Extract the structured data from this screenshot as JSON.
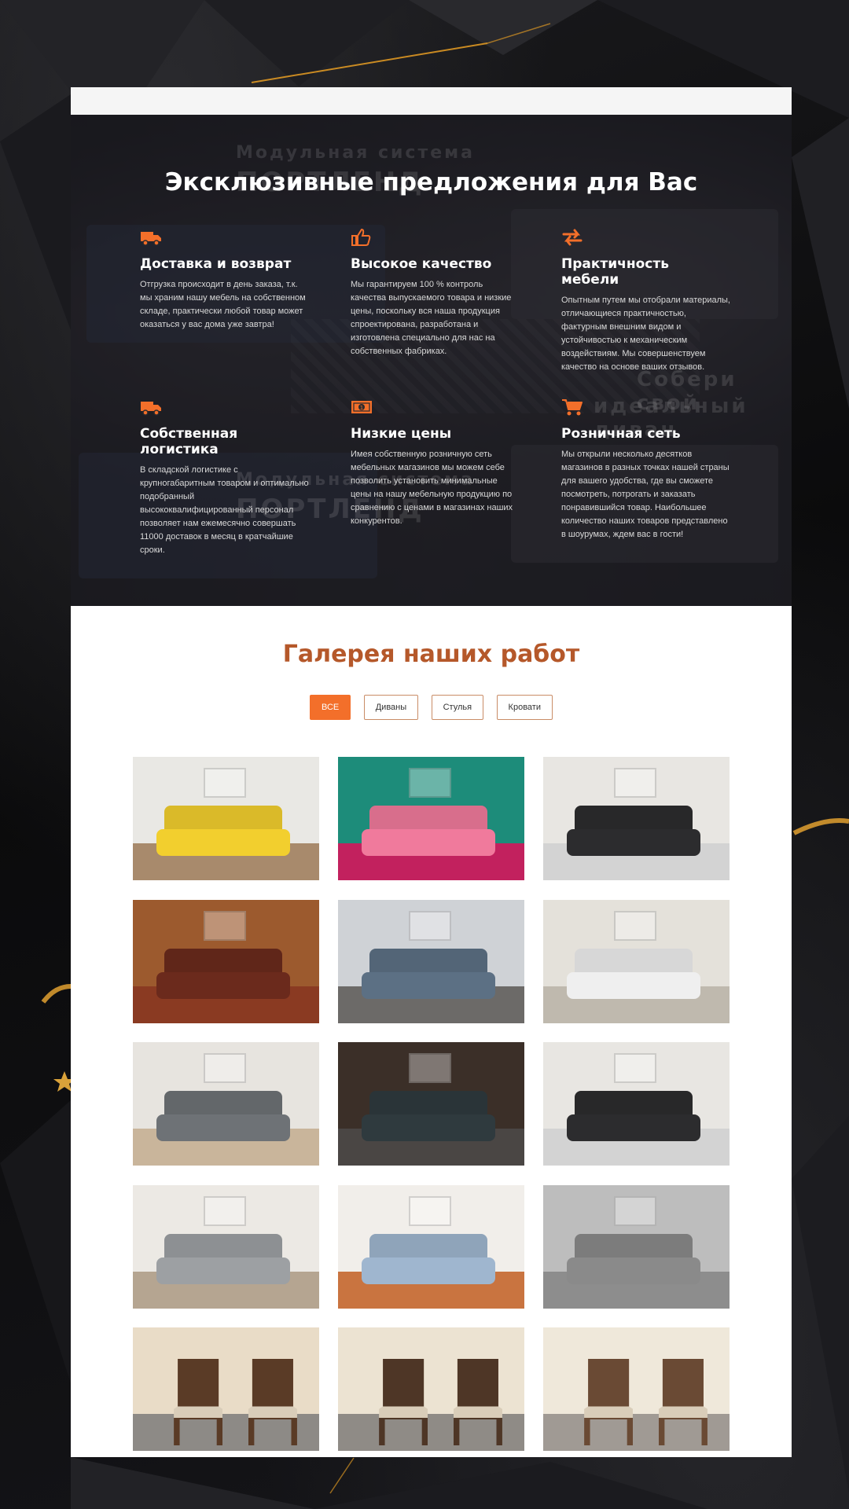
{
  "hero": {
    "ghost_text_1": "Модульная система",
    "ghost_text_2": "ПОРТЛЕНД",
    "ghost_text_3": "Собери свой",
    "ghost_text_4": "идеальный диван",
    "title": "Эксклюзивные предложения для Вас",
    "features": [
      {
        "icon": "truck-icon",
        "title": "Доставка и возврат",
        "text": "Отгрузка происходит в день заказа, т.к. мы храним нашу мебель на собственном складе, практически любой товар может оказаться у вас дома уже завтра!"
      },
      {
        "icon": "thumbs-up-icon",
        "title": "Высокое качество",
        "text": "Мы гарантируем 100 % контроль качества выпускаемого товара и низкие цены, поскольку вся наша продукция спроектирована, разработана и изготовлена специально для нас на собственных фабриках."
      },
      {
        "icon": "exchange-arrows-icon",
        "title": "Практичность мебели",
        "text": "Опытным путем мы отобрали материалы, отличающиеся практичностью, фактурным внешним видом и устойчивостью к механическим воздействиям. Мы совершенствуем качество на основе ваших отзывов."
      },
      {
        "icon": "truck-icon",
        "title": "Собственная логистика",
        "text": "В складской логистике с крупногабаритным товаром и оптимально подобранный высококвалифицированный персонал позволяет нам ежемесячно совершать 11000 доставок в месяц в кратчайшие сроки."
      },
      {
        "icon": "money-icon",
        "title": "Низкие цены",
        "text": "Имея собственную розничную сеть мебельных магазинов мы можем себе позволить установить минимальные цены на нашу мебельную продукцию по сравнению с ценами в магазинах наших конкурентов."
      },
      {
        "icon": "cart-icon",
        "title": "Розничная сеть",
        "text": "Мы открыли несколько десятков магазинов в разных точках нашей страны для вашего удобства, где вы сможете посмотреть, потрогать и заказать понравившийся товар. Наибольшее количество наших товаров представлено в шоурумах, ждем вас в гости!"
      }
    ]
  },
  "gallery": {
    "title": "Галерея наших работ",
    "filters": [
      "ВСЕ",
      "Диваны",
      "Стулья",
      "Кровати"
    ],
    "active_filter": "ВСЕ",
    "tiles": [
      {
        "subject": "yellow-sofa-photo",
        "wall": "#e9e8e4",
        "floor": "#a88a6c",
        "sofa": "#f2cf2e"
      },
      {
        "subject": "pink-neon-lounge-photo",
        "wall": "#1d8c7a",
        "floor": "#c2215e",
        "sofa": "#f07a9c"
      },
      {
        "subject": "dark-corner-sofa-photo",
        "wall": "#e8e6e2",
        "floor": "#d3d3d3",
        "sofa": "#2c2c2e"
      },
      {
        "subject": "striped-antique-sofa-photo",
        "wall": "#9c5a2e",
        "floor": "#8a3a22",
        "sofa": "#6b2a1c"
      },
      {
        "subject": "blue-sectional-photo",
        "wall": "#cfd2d6",
        "floor": "#6c6a68",
        "sofa": "#5c7084"
      },
      {
        "subject": "white-sofa-teal-photo",
        "wall": "#e4e1da",
        "floor": "#bfb9ae",
        "sofa": "#efefef"
      },
      {
        "subject": "grey-sofa-floral-photo",
        "wall": "#e7e4df",
        "floor": "#c9b59b",
        "sofa": "#6e7276"
      },
      {
        "subject": "dark-sofa-wood-photo",
        "wall": "#3b2f28",
        "floor": "#4a4644",
        "sofa": "#2f3a3e"
      },
      {
        "subject": "dark-corner-sofa-photo",
        "wall": "#e8e6e2",
        "floor": "#d3d3d3",
        "sofa": "#2c2c2e"
      },
      {
        "subject": "grey-tufted-sofa-photo",
        "wall": "#ece9e4",
        "floor": "#b5a591",
        "sofa": "#9da0a3"
      },
      {
        "subject": "light-blue-sofa-photo",
        "wall": "#f1eeea",
        "floor": "#c97440",
        "sofa": "#9fb6cf"
      },
      {
        "subject": "grey-channel-sofa-photo",
        "wall": "#bdbdbd",
        "floor": "#8d8d8d",
        "sofa": "#8a8a8a"
      },
      {
        "subject": "bar-stools-photo",
        "wall": "#e9dcc7",
        "floor": "#8d8a86",
        "sofa": "#5a3b26"
      },
      {
        "subject": "wooden-chairs-photo",
        "wall": "#ece3d2",
        "floor": "#8f8b86",
        "sofa": "#4e3626"
      },
      {
        "subject": "upholstered-chairs-photo",
        "wall": "#efe8da",
        "floor": "#a09a94",
        "sofa": "#6a4a34"
      }
    ]
  },
  "colors": {
    "accent": "#f36f2a",
    "gallery_title": "#b5582a"
  }
}
